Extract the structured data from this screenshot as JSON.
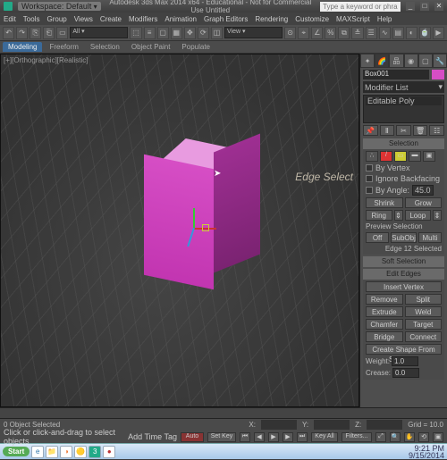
{
  "titlebar": {
    "workspace_label": "Workspace: Default",
    "app_title": "Autodesk 3ds Max 2014 x64 - Educational - Not for Commercial Use   Untitled",
    "search_placeholder": "Type a keyword or phrase"
  },
  "menu": {
    "items": [
      "Edit",
      "Tools",
      "Group",
      "Views",
      "Create",
      "Modifiers",
      "Animation",
      "Graph Editors",
      "Rendering",
      "Customize",
      "MAXScript",
      "Help"
    ]
  },
  "ribbon": {
    "tabs": [
      "Modeling",
      "Freeform",
      "Selection",
      "Object Paint",
      "Populate"
    ]
  },
  "viewport": {
    "label": "[+][Orthographic][Realistic]",
    "hint": "Edge Select"
  },
  "command": {
    "object_name": "Box001",
    "modifier_list_label": "Modifier List",
    "stack_item": "Editable Poly",
    "rollouts": {
      "selection": "Selection",
      "soft_selection": "Soft Selection",
      "edit_edges": "Edit Edges"
    },
    "selection": {
      "by_vertex": "By Vertex",
      "ignore_backfacing": "Ignore Backfacing",
      "by_angle": "By Angle:",
      "angle": "45.0",
      "shrink": "Shrink",
      "grow": "Grow",
      "ring": "Ring",
      "loop": "Loop",
      "preview_label": "Preview Selection",
      "preview_off": "Off",
      "preview_subobj": "SubObj",
      "preview_multi": "Multi",
      "status": "Edge 12 Selected"
    },
    "edit": {
      "insert_vertex": "Insert Vertex",
      "remove": "Remove",
      "split": "Split",
      "extrude": "Extrude",
      "weld": "Weld",
      "chamfer": "Chamfer",
      "target_weld": "Target Weld",
      "bridge": "Bridge",
      "connect": "Connect",
      "create_shape": "Create Shape From Selection",
      "weight": "Weight:",
      "weight_val": "1.0",
      "crease": "Crease:",
      "crease_val": "0.0"
    }
  },
  "status": {
    "selected": "0 Object Selected",
    "hint": "Click or click-and-drag to select objects",
    "x": "X:",
    "y": "Y:",
    "z": "Z:",
    "grid": "Grid = 10.0",
    "autokey": "Auto",
    "setkey": "Set Key",
    "addtag": "Add Time Tag",
    "keyall": "Key All",
    "filters": "Filters..."
  },
  "taskbar": {
    "start": "Start",
    "time": "9:21 PM",
    "date": "9/15/2014"
  }
}
